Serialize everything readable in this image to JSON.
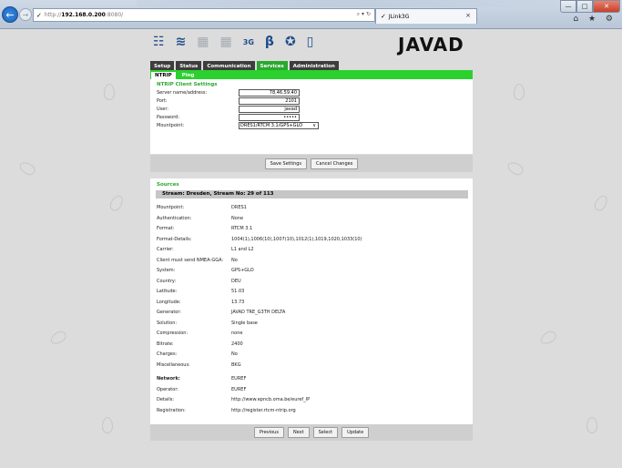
{
  "browser": {
    "url_prefix": "http://",
    "url_host": "192.168.0.200",
    "url_port": ":8080/",
    "tab_title": "JLink3G",
    "address_tools": "⌕ ▾ ↻",
    "right_icons": "⌂ ★ ⚙"
  },
  "device": {
    "logo": "JAVAD",
    "icon_3g_label": "3G"
  },
  "main_tabs": [
    "Setup",
    "Status",
    "Communication",
    "Services",
    "Administration"
  ],
  "sub_tabs": [
    "NTRIP",
    "Ping"
  ],
  "ntrip": {
    "section_title": "NTRIP Client Settings",
    "fields": [
      {
        "label": "Server name/address:",
        "value": "78.46.59.40"
      },
      {
        "label": "Port:",
        "value": "2101"
      },
      {
        "label": "User:",
        "value": "javad"
      },
      {
        "label": "Password:",
        "value": "•••••"
      }
    ],
    "mountpoint_label": "Mountpoint:",
    "mountpoint_value": "DRES1/RTCM 3.1/GPS+GLO"
  },
  "buttons": {
    "save": "Save Settings",
    "cancel": "Cancel Changes",
    "previous": "Previous",
    "next": "Next",
    "select": "Select",
    "update": "Update"
  },
  "sources": {
    "section_title": "Sources",
    "stream_header": "Stream: Dresden, Stream No: 29 of 113",
    "rows": [
      {
        "label": "Mountpoint:",
        "value": "DRES1"
      },
      {
        "label": "Authentication:",
        "value": "None"
      },
      {
        "label": "Format:",
        "value": "RTCM 3.1"
      },
      {
        "label": "Format-Details:",
        "value": "1004(1),1006(10),1007(10),1012(1),1019,1020,1033(10)"
      },
      {
        "label": "Carrier:",
        "value": "L1 and L2"
      },
      {
        "label": "Client must send NMEA-GGA:",
        "value": "No"
      },
      {
        "label": "System:",
        "value": "GPS+GLO"
      },
      {
        "label": "Country:",
        "value": "DEU"
      },
      {
        "label": "Latitude:",
        "value": "51.03"
      },
      {
        "label": "Longitude:",
        "value": "13.73"
      },
      {
        "label": "Generator:",
        "value": "JAVAD TRE_G3TH DELTA"
      },
      {
        "label": "Solution:",
        "value": "Single base"
      },
      {
        "label": "Compression:",
        "value": "none"
      },
      {
        "label": "Bitrate:",
        "value": "2400"
      },
      {
        "label": "Charges:",
        "value": "No"
      },
      {
        "label": "Miscellaneous:",
        "value": "BKG"
      }
    ],
    "network_rows": [
      {
        "label": "Network:",
        "value": "EUREF"
      },
      {
        "label": "Operator:",
        "value": "EUREF"
      },
      {
        "label": "Details:",
        "value": "http://www.epncb.oma.be/euref_IP"
      },
      {
        "label": "Registration:",
        "value": "http://register.rtcm-ntrip.org"
      }
    ]
  }
}
